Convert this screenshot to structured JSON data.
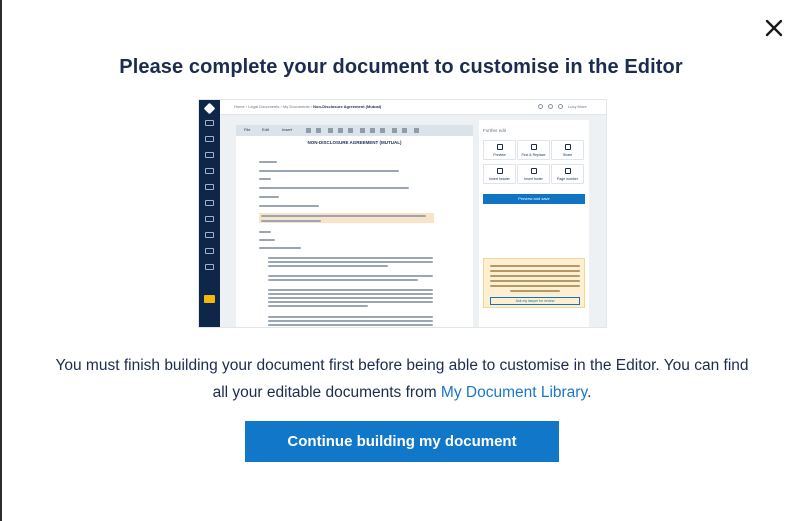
{
  "dialog": {
    "title": "Please complete your document to customise in the Editor",
    "message_prefix": "You must finish building your document first before being able to customise in the Editor. You can find all your editable documents from ",
    "library_link": "My Document Library",
    "message_suffix": ".",
    "continue_label": "Continue building my document"
  },
  "preview": {
    "breadcrumb_prefix": "Home › Legal Documents › My Documents › ",
    "breadcrumb_current": "Non-Disclosure Agreement (Mutual)",
    "user_label": "Lucy More",
    "toolbar": [
      "File",
      "Edit",
      "Insert"
    ],
    "doc_title": "NON-DISCLOSURE AGREEMENT (MUTUAL)",
    "panel": {
      "heading": "Further edit",
      "buttons": [
        "Preview",
        "Find & Replace",
        "Share",
        "Insert header",
        "Insert footer",
        "Page number"
      ],
      "primary": "Preview and save",
      "note_cta": "Ask my lawyer for review"
    }
  },
  "colors": {
    "accent": "#1177c9",
    "title": "#1c2c4f",
    "sidebar": "#0e2749"
  }
}
